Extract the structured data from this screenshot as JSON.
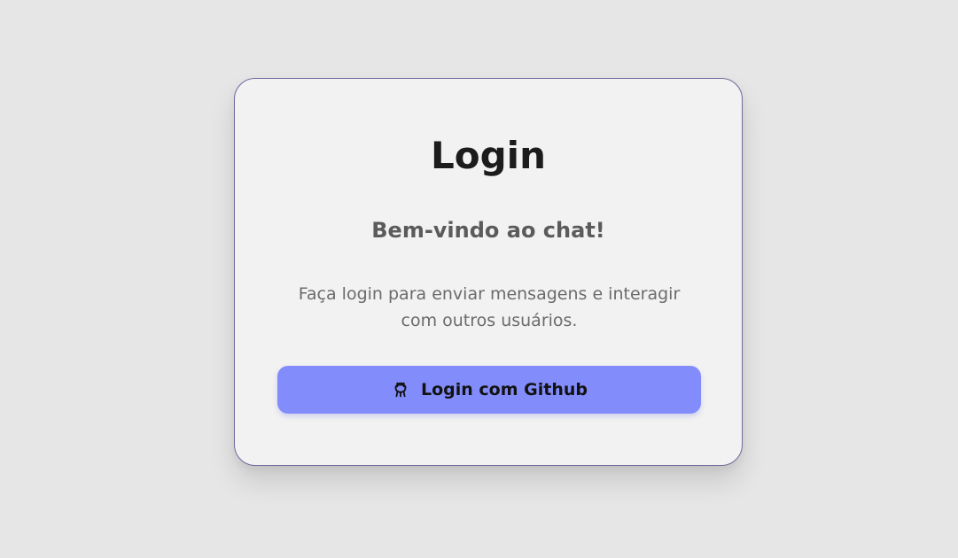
{
  "card": {
    "title": "Login",
    "subtitle": "Bem-vindo ao chat!",
    "description": "Faça login para enviar mensagens e interagir com outros usuários.",
    "login_button": {
      "label": "Login com Github",
      "icon": "github-icon"
    }
  },
  "colors": {
    "background": "#e6e6e6",
    "card_background": "#f2f2f2",
    "card_border": "#6f6a9c",
    "button_accent": "#828cfa"
  }
}
